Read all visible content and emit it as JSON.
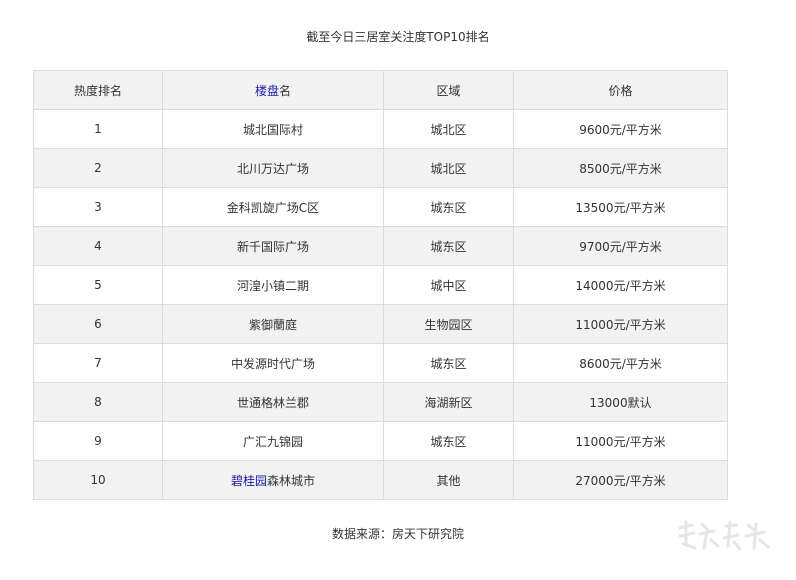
{
  "title": "截至今日三居室关注度TOP10排名",
  "table": {
    "headers": {
      "rank": "热度排名",
      "name_link": "楼盘",
      "name_suffix": "名",
      "district": "区域",
      "price": "价格"
    },
    "rows": [
      {
        "rank": "1",
        "name": "城北国际村",
        "district": "城北区",
        "price": "9600元/平方米"
      },
      {
        "rank": "2",
        "name": "北川万达广场",
        "district": "城北区",
        "price": "8500元/平方米"
      },
      {
        "rank": "3",
        "name": "金科凯旋广场C区",
        "district": "城东区",
        "price": "13500元/平方米"
      },
      {
        "rank": "4",
        "name": "新千国际广场",
        "district": "城东区",
        "price": "9700元/平方米"
      },
      {
        "rank": "5",
        "name": "河湟小镇二期",
        "district": "城中区",
        "price": "14000元/平方米"
      },
      {
        "rank": "6",
        "name": "紫御蘭庭",
        "district": "生物园区",
        "price": "11000元/平方米"
      },
      {
        "rank": "7",
        "name": "中发源时代广场",
        "district": "城东区",
        "price": "8600元/平方米"
      },
      {
        "rank": "8",
        "name": "世通格林兰郡",
        "district": "海湖新区",
        "price": "13000默认"
      },
      {
        "rank": "9",
        "name": "广汇九锦园",
        "district": "城东区",
        "price": "11000元/平方米"
      },
      {
        "rank": "10",
        "name_link": "碧桂园",
        "name_rest": "森林城市",
        "district": "其他",
        "price": "27000元/平方米"
      }
    ]
  },
  "source": "数据来源：房天下研究院",
  "colors": {
    "link": "#1a1aa6",
    "header_bg": "#f2f2f2",
    "stripe_bg": "#f2f2f2",
    "border": "#dcdcdc"
  }
}
